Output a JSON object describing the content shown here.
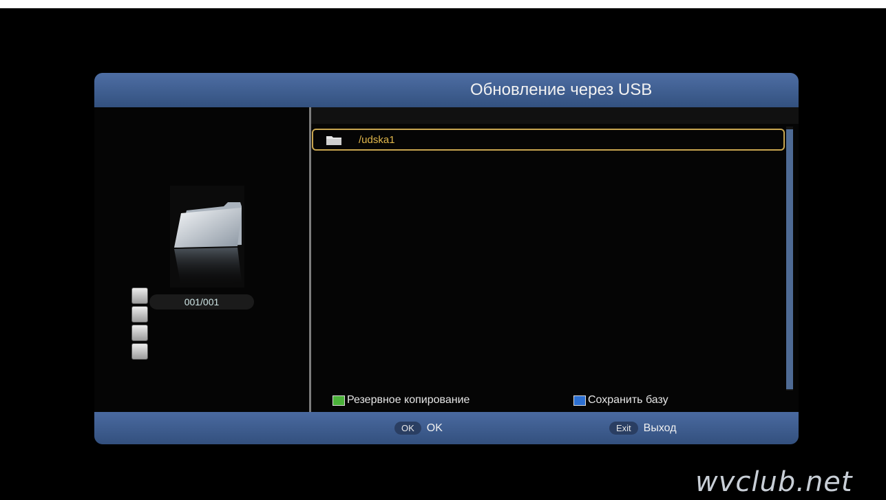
{
  "window": {
    "title": "Обновление через USB"
  },
  "left_panel": {
    "counter": "001/001"
  },
  "file_list": {
    "items": [
      {
        "label": "/udska1",
        "selected": true
      }
    ]
  },
  "hints": {
    "green_label": "Резервное копирование",
    "blue_label": "Сохранить базу",
    "green_color": "#4bb23a",
    "blue_color": "#2c6fd1"
  },
  "footer": {
    "ok_key": "OK",
    "ok_label": "OK",
    "exit_key": "Exit",
    "exit_label": "Выход"
  },
  "watermark": "wvclub.net",
  "colors": {
    "accent": "#3c5b8e",
    "selection": "#c9a650",
    "item_text": "#e2b84c"
  }
}
